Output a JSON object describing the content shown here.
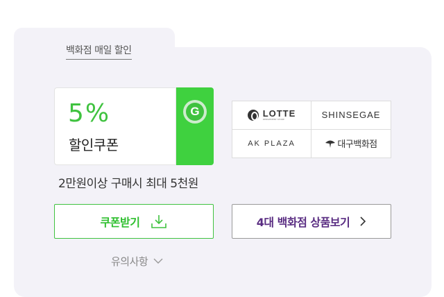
{
  "section": {
    "tab_label": "백화점 매일 할인"
  },
  "coupon": {
    "percent": "5%",
    "label": "할인쿠폰",
    "badge_letter": "G",
    "condition": "2만원이상 구매시 최대 5천원",
    "accent_color": "#3fc23f"
  },
  "stores": [
    {
      "name": "LOTTE",
      "sub": "DEPARTMENT STORE"
    },
    {
      "name": "SHINSEGAE"
    },
    {
      "name": "AK PLAZA"
    },
    {
      "name": "대구백화점"
    }
  ],
  "buttons": {
    "download_label": "쿠폰받기",
    "products_label": "4대 백화점 상품보기"
  },
  "notice": {
    "label": "유의사항"
  }
}
